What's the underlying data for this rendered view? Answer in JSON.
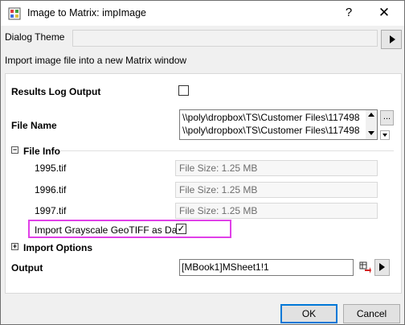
{
  "window": {
    "title": "Image to Matrix: impImage",
    "help_glyph": "?",
    "close_glyph": "✕"
  },
  "theme": {
    "label": "Dialog Theme",
    "value": ""
  },
  "description": "Import image file into a new Matrix window",
  "results_log": {
    "label": "Results Log Output",
    "checked": false
  },
  "file_name": {
    "label": "File Name",
    "lines": [
      "\\\\poly\\dropbox\\TS\\Customer Files\\117498",
      "\\\\poly\\dropbox\\TS\\Customer Files\\117498"
    ],
    "browse_label": "..."
  },
  "file_info": {
    "label": "File Info",
    "expander": "−",
    "files": [
      {
        "name": "1995.tif",
        "size": "File Size: 1.25 MB"
      },
      {
        "name": "1996.tif",
        "size": "File Size: 1.25 MB"
      },
      {
        "name": "1997.tif",
        "size": "File Size: 1.25 MB"
      }
    ]
  },
  "geotiff": {
    "label": "Import Grayscale GeoTIFF as Data",
    "checked": true,
    "check_glyph": "✓"
  },
  "import_options": {
    "label": "Import Options",
    "expander": "+"
  },
  "output": {
    "label": "Output",
    "value": "[MBook1]MSheet1!1"
  },
  "buttons": {
    "ok": "OK",
    "cancel": "Cancel"
  },
  "colors": {
    "highlight": "#e040e8",
    "ok_border": "#0078d7"
  }
}
